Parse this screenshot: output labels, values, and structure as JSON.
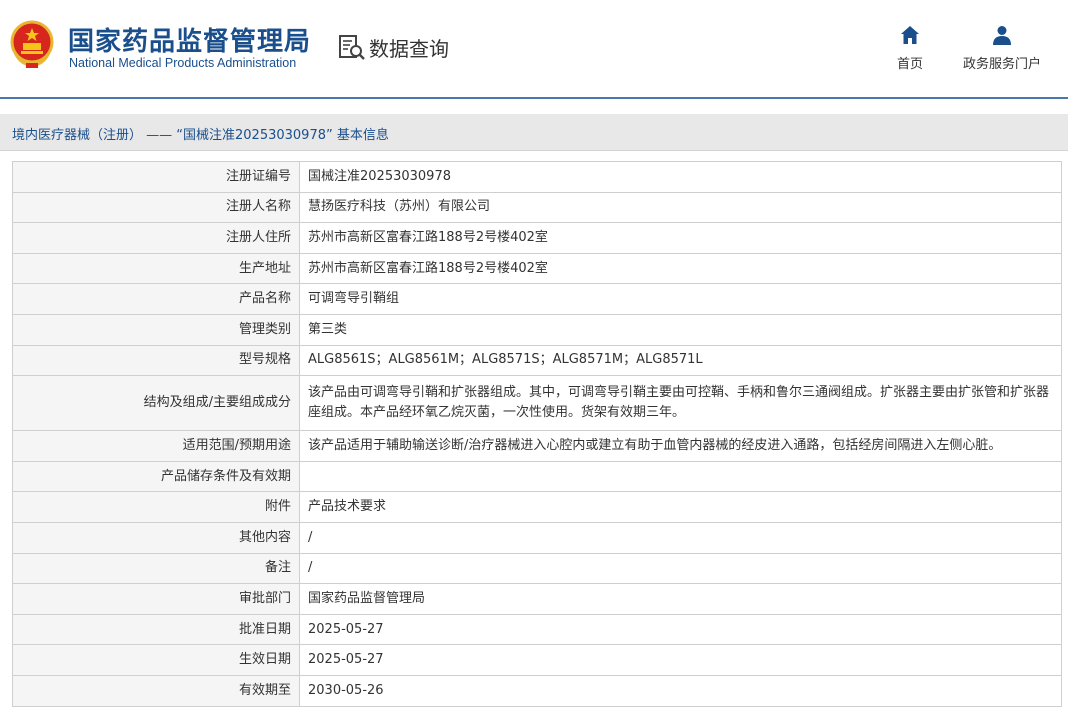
{
  "header": {
    "brand_cn": "国家药品监督管理局",
    "brand_en": "National Medical Products Administration",
    "data_query": "数据查询",
    "nav": {
      "home": "首页",
      "gov_service": "政务服务门户"
    }
  },
  "breadcrumb": "境内医疗器械（注册） —— “国械注准20253030978” 基本信息",
  "colors": {
    "brand": "#1a4f8c",
    "header_line": "#4a78ae",
    "breadcrumb_bg": "#e8e8e8",
    "label_bg": "#f5f5f5"
  },
  "table": [
    {
      "label": "注册证编号",
      "value": "国械注准20253030978"
    },
    {
      "label": "注册人名称",
      "value": "慧扬医疗科技（苏州）有限公司"
    },
    {
      "label": "注册人住所",
      "value": "苏州市高新区富春江路188号2号楼402室"
    },
    {
      "label": "生产地址",
      "value": "苏州市高新区富春江路188号2号楼402室"
    },
    {
      "label": "产品名称",
      "value": "可调弯导引鞘组"
    },
    {
      "label": "管理类别",
      "value": "第三类"
    },
    {
      "label": "型号规格",
      "value": "ALG8561S；ALG8561M；ALG8571S；ALG8571M；ALG8571L"
    },
    {
      "label": "结构及组成/主要组成成分",
      "value": "该产品由可调弯导引鞘和扩张器组成。其中，可调弯导引鞘主要由可控鞘、手柄和鲁尔三通阀组成。扩张器主要由扩张管和扩张器座组成。本产品经环氧乙烷灭菌，一次性使用。货架有效期三年。"
    },
    {
      "label": "适用范围/预期用途",
      "value": "该产品适用于辅助输送诊断/治疗器械进入心腔内或建立有助于血管内器械的经皮进入通路，包括经房间隔进入左侧心脏。"
    },
    {
      "label": "产品储存条件及有效期",
      "value": ""
    },
    {
      "label": "附件",
      "value": "产品技术要求"
    },
    {
      "label": "其他内容",
      "value": "/"
    },
    {
      "label": "备注",
      "value": "/"
    },
    {
      "label": "审批部门",
      "value": "国家药品监督管理局"
    },
    {
      "label": "批准日期",
      "value": "2025-05-27"
    },
    {
      "label": "生效日期",
      "value": "2025-05-27"
    },
    {
      "label": "有效期至",
      "value": "2030-05-26"
    }
  ]
}
